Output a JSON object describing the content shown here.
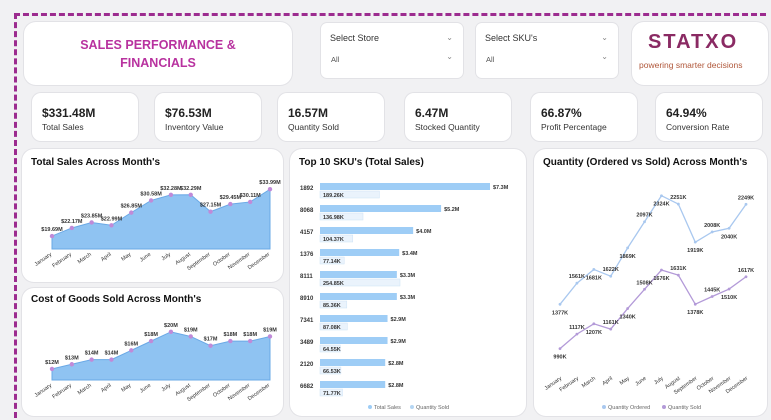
{
  "header": {
    "title_line1": "SALES PERFORMANCE &",
    "title_line2": "FINANCIALS"
  },
  "slicers": [
    {
      "label": "Select Store",
      "value": "All"
    },
    {
      "label": "Select SKU's",
      "value": "All"
    }
  ],
  "logo": {
    "name": "STATXO",
    "tagline": "powering smarter decisions"
  },
  "kpis": [
    {
      "value": "$331.48M",
      "label": "Total Sales"
    },
    {
      "value": "$76.53M",
      "label": "Inventory Value"
    },
    {
      "value": "16.57M",
      "label": "Quantity Sold"
    },
    {
      "value": "6.47M",
      "label": "Stocked Quantity"
    },
    {
      "value": "66.87%",
      "label": "Profit Percentage"
    },
    {
      "value": "64.94%",
      "label": "Conversion Rate"
    }
  ],
  "colors": {
    "accent": "#b8329f",
    "area_fill": "#8fc3f2",
    "bar": "#9ecdf6",
    "dot": "#c08ad8",
    "line_ordered": "#a9c8ef",
    "line_sold": "#b39ad8"
  },
  "chart_data": [
    {
      "type": "area",
      "title": "Total Sales Across Month's",
      "categories": [
        "January",
        "February",
        "March",
        "April",
        "May",
        "June",
        "July",
        "August",
        "September",
        "October",
        "November",
        "December"
      ],
      "values": [
        19.69,
        22.17,
        23.85,
        22.99,
        26.85,
        30.58,
        32.28,
        32.29,
        27.15,
        29.45,
        30.11,
        33.99
      ],
      "labels": [
        "$19.69M",
        "$22.17M",
        "$23.85M",
        "$22.99M",
        "$26.85M",
        "$30.58M",
        "$32.28M",
        "$32.29M",
        "$27.15M",
        "$29.45M",
        "$30.11M",
        "$33.99M"
      ]
    },
    {
      "type": "area",
      "title": "Cost of Goods Sold Across Month's",
      "categories": [
        "January",
        "February",
        "March",
        "April",
        "May",
        "June",
        "July",
        "August",
        "September",
        "October",
        "November",
        "December"
      ],
      "values": [
        12,
        13,
        14,
        14,
        16,
        18,
        20,
        19,
        17,
        18,
        18,
        19
      ],
      "labels": [
        "$12M",
        "$13M",
        "$14M",
        "$14M",
        "$16M",
        "$18M",
        "$20M",
        "$19M",
        "$17M",
        "$18M",
        "$18M",
        "$19M"
      ]
    },
    {
      "type": "bar",
      "title": "Top 10 SKU's (Total Sales)",
      "categories": [
        "1892",
        "8068",
        "4157",
        "1376",
        "8111",
        "8910",
        "7341",
        "3489",
        "2120",
        "6682"
      ],
      "series": [
        {
          "name": "Total Sales",
          "values": [
            7.3,
            5.2,
            4.0,
            3.4,
            3.3,
            3.3,
            2.9,
            2.9,
            2.8,
            2.8
          ],
          "labels": [
            "$7.3M",
            "$5.2M",
            "$4.0M",
            "$3.4M",
            "$3.3M",
            "$3.3M",
            "$2.9M",
            "$2.9M",
            "$2.8M",
            "$2.8M"
          ]
        },
        {
          "name": "Quantity Sold",
          "values": [
            189.26,
            136.98,
            104.37,
            77.14,
            254.85,
            85.36,
            87.08,
            64.55,
            66.53,
            71.77
          ],
          "labels": [
            "189.26K",
            "136.98K",
            "104.37K",
            "77.14K",
            "254.85K",
            "85.36K",
            "87.08K",
            "64.55K",
            "66.53K",
            "71.77K"
          ]
        }
      ],
      "legend": "bottom"
    },
    {
      "type": "line",
      "title": "Quantity (Ordered vs Sold) Across Month's",
      "categories": [
        "January",
        "February",
        "March",
        "April",
        "May",
        "June",
        "July",
        "August",
        "September",
        "October",
        "November",
        "December"
      ],
      "series": [
        {
          "name": "Quantity Ordered",
          "values": [
            1377,
            1561,
            1681,
            1622,
            1869,
            2097,
            2324,
            2251,
            1919,
            2008,
            2040,
            2249
          ],
          "labels": [
            "1377K",
            "1561K",
            "1681K",
            "1622K",
            "1869K",
            "2097K",
            "2324K",
            "2251K",
            "1919K",
            "2008K",
            "2040K",
            "2249K"
          ]
        },
        {
          "name": "Quantity Sold",
          "values": [
            990,
            1117,
            1207,
            1161,
            1340,
            1508,
            1676,
            1631,
            1378,
            1445,
            1510,
            1617
          ],
          "labels": [
            "990K",
            "1117K",
            "1207K",
            "1161K",
            "1340K",
            "1508K",
            "1676K",
            "1631K",
            "1378K",
            "1445K",
            "1510K",
            "1617K"
          ]
        }
      ],
      "legend": "bottom"
    }
  ]
}
